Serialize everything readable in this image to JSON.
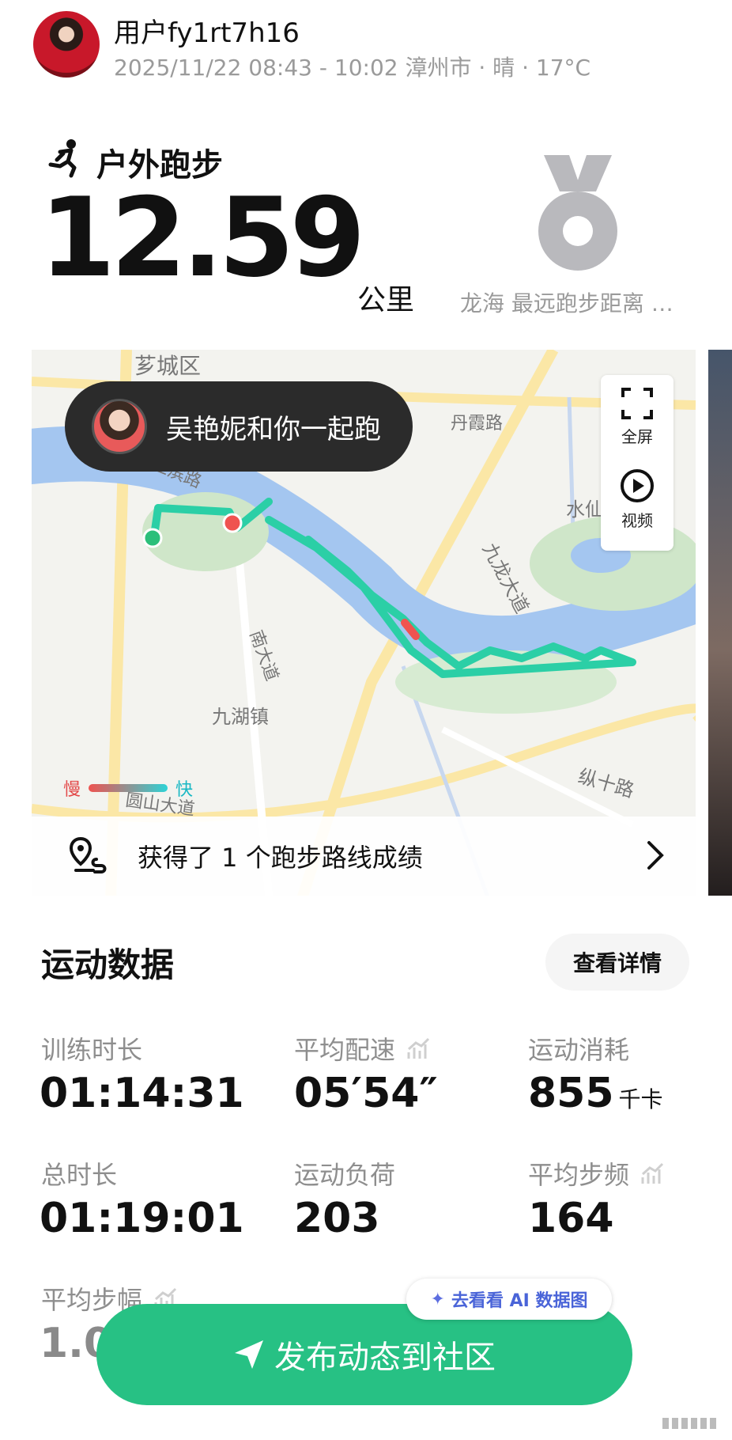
{
  "header": {
    "username": "用户fy1rt7h16",
    "subline": "2025/11/22 08:43 - 10:02 漳州市 · 晴 · 17°C"
  },
  "activity": {
    "type_label": "户外跑步",
    "distance": "12.59",
    "distance_unit": "公里",
    "medal_caption": "龙海 最远跑步距离 …"
  },
  "map": {
    "companion_text": "吴艳妮和你一起跑",
    "fullscreen_label": "全屏",
    "video_label": "视频",
    "legend_slow": "慢",
    "legend_fast": "快",
    "labels": {
      "zhicheng": "芗城区",
      "jiangbin": "江滨路",
      "danxia": "丹霞路",
      "shuixian": "水仙大",
      "jiulong": "九龙大道",
      "nan": "南大道",
      "jiuhu": "九湖镇",
      "zongshi": "纵十路",
      "yuanshan": "圆山大道"
    },
    "achievement_text": "获得了 1 个跑步路线成绩"
  },
  "stats": {
    "section_title": "运动数据",
    "details_label": "查看详情",
    "items": [
      {
        "label": "训练时长",
        "value": "01:14:31",
        "unit": ""
      },
      {
        "label": "平均配速",
        "value": "05′54″",
        "unit": ""
      },
      {
        "label": "运动消耗",
        "value": "855",
        "unit": "千卡"
      },
      {
        "label": "总时长",
        "value": "01:19:01",
        "unit": ""
      },
      {
        "label": "运动负荷",
        "value": "203",
        "unit": ""
      },
      {
        "label": "平均步频",
        "value": "164",
        "unit": ""
      },
      {
        "label": "平均步幅",
        "value": "1.0",
        "unit": ""
      }
    ]
  },
  "ai_chip_label": "去看看 AI 数据图",
  "publish_label": "发布动态到社区",
  "colors": {
    "brand_green": "#27c184",
    "route_teal": "#2bcfa6",
    "river": "#a4c6f0",
    "medal_gray": "#b9b9bd"
  }
}
